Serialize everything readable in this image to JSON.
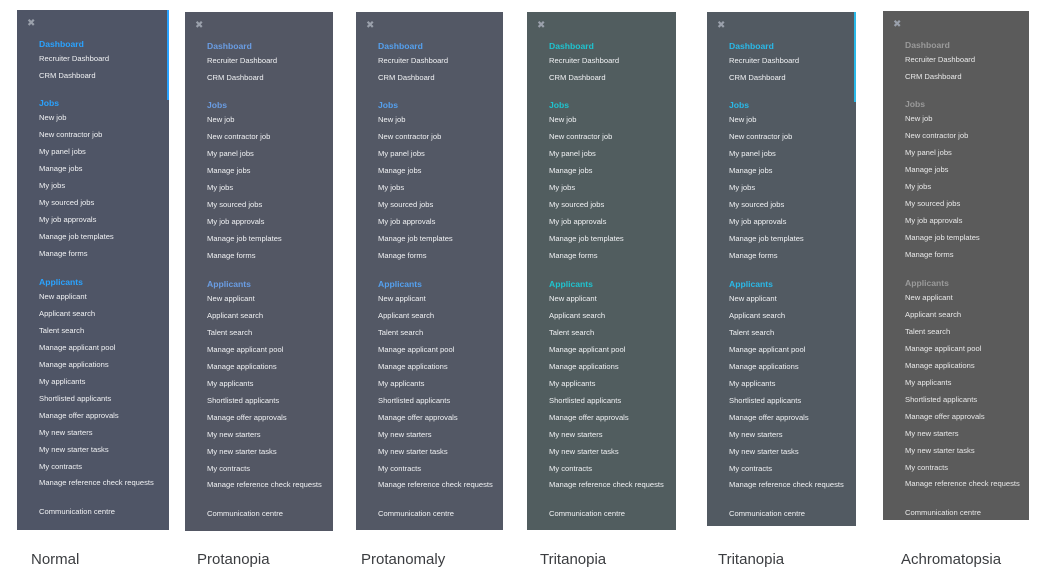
{
  "nav": {
    "sections": [
      {
        "title": "Dashboard",
        "items": [
          "Recruiter Dashboard",
          "CRM Dashboard"
        ]
      },
      {
        "title": "Jobs",
        "items": [
          "New job",
          "New contractor job",
          "My panel jobs",
          "Manage jobs",
          "My jobs",
          "My sourced jobs",
          "My job approvals",
          "Manage job templates",
          "Manage forms"
        ]
      },
      {
        "title": "Applicants",
        "items": [
          "New applicant",
          "Applicant search",
          "Talent search",
          "Manage applicant pool",
          "Manage applications",
          "My applicants",
          "Shortlisted applicants",
          "Manage offer approvals",
          "My new starters",
          "My new starter tasks",
          "My contracts",
          "Manage reference check requests",
          "Communication centre"
        ]
      }
    ]
  },
  "close_icon": "close-icon",
  "panels": [
    {
      "caption": "Normal",
      "bg": "#4f5566",
      "heading_color": "#2aa3ff",
      "accent": "#2aa3ff"
    },
    {
      "caption": "Protanopia",
      "bg": "#535764",
      "heading_color": "#6a9de3",
      "accent": "#535764"
    },
    {
      "caption": "Protanomaly",
      "bg": "#535865",
      "heading_color": "#55a0ee",
      "accent": "#535865"
    },
    {
      "caption": "Tritanopia",
      "bg": "#515d5f",
      "heading_color": "#1fc3cf",
      "accent": "#515d5f"
    },
    {
      "caption": "Tritanopia",
      "bg": "#525a62",
      "heading_color": "#2ab9e8",
      "accent": "#2ab9e8"
    },
    {
      "caption": "Achromatopsia",
      "bg": "#5b5b5b",
      "heading_color": "#9a9a9a",
      "accent": "#5b5b5b"
    }
  ]
}
